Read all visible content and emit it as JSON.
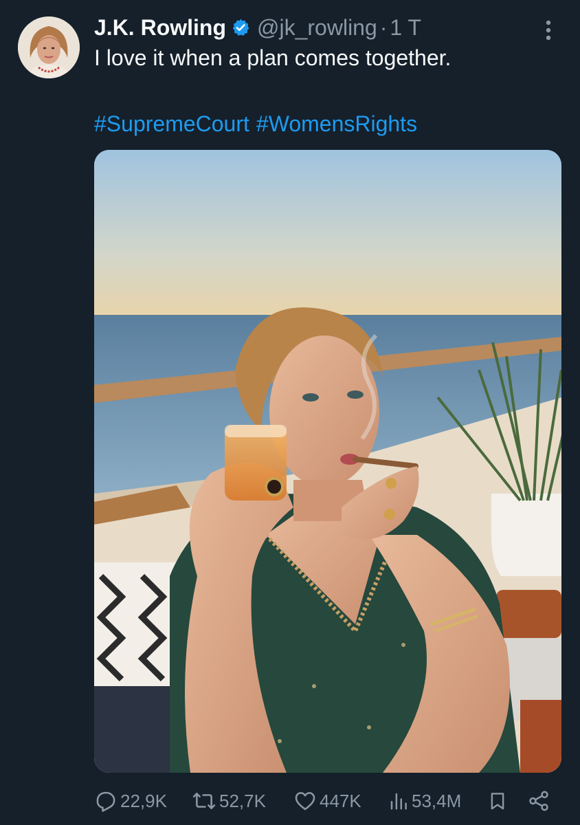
{
  "tweet": {
    "author_name": "J.K. Rowling",
    "handle": "@jk_rowling",
    "separator": "·",
    "time": "1 T",
    "text": "I love it when a plan comes together.",
    "hashtags": [
      "#SupremeCourt",
      "#WomensRights"
    ]
  },
  "stats": {
    "replies": "22,9K",
    "retweets": "52,7K",
    "likes": "447K",
    "views": "53,4M"
  },
  "colors": {
    "background": "#15202b",
    "text": "#f7f9f9",
    "secondary": "#8b98a5",
    "link": "#1d9bf0",
    "verified": "#1d9bf0"
  },
  "icons": {
    "verified": "verified-badge-icon",
    "more": "more-vertical-icon",
    "reply": "reply-icon",
    "retweet": "retweet-icon",
    "like": "heart-icon",
    "views": "views-bar-icon",
    "bookmark": "bookmark-icon",
    "share": "share-icon"
  }
}
